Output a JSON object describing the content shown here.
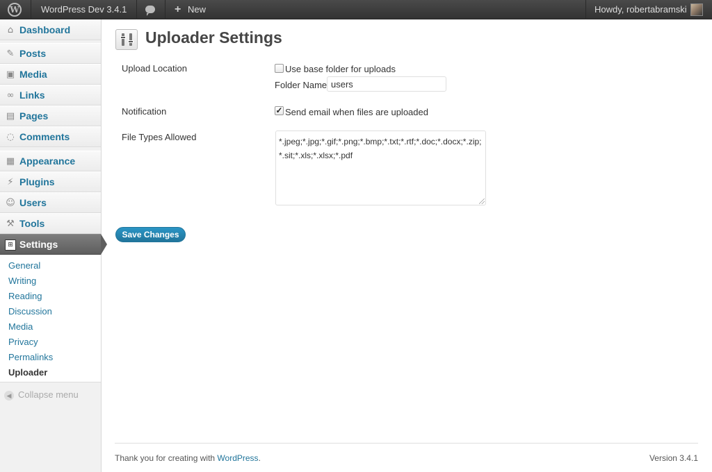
{
  "adminbar": {
    "site_name": "WordPress Dev 3.4.1",
    "new_label": "New",
    "greeting": "Howdy, robertabramski",
    "icons": [
      "wordpress-logo-icon",
      "comment-bubble-icon",
      "plus-icon",
      "avatar-image"
    ]
  },
  "sidebar": {
    "items": [
      {
        "label": "Dashboard",
        "icon": "home-icon"
      },
      {
        "label": "Posts",
        "icon": "pushpin-icon"
      },
      {
        "label": "Media",
        "icon": "media-icon"
      },
      {
        "label": "Links",
        "icon": "link-icon"
      },
      {
        "label": "Pages",
        "icon": "pages-icon"
      },
      {
        "label": "Comments",
        "icon": "comment-icon"
      },
      {
        "label": "Appearance",
        "icon": "appearance-icon"
      },
      {
        "label": "Plugins",
        "icon": "plug-icon"
      },
      {
        "label": "Users",
        "icon": "users-icon"
      },
      {
        "label": "Tools",
        "icon": "tools-icon"
      },
      {
        "label": "Settings",
        "icon": "settings-icon"
      }
    ],
    "submenu": [
      "General",
      "Writing",
      "Reading",
      "Discussion",
      "Media",
      "Privacy",
      "Permalinks",
      "Uploader"
    ],
    "collapse_label": "Collapse menu",
    "accent": "#21759b"
  },
  "main": {
    "title": "Uploader Settings",
    "upload_location_label": "Upload Location",
    "base_folder_label": "Use base folder for uploads",
    "base_folder_checked": false,
    "folder_name_label": "Folder Name",
    "folder_name_value": "users",
    "notification_label": "Notification",
    "send_email_label": "Send email when files are uploaded",
    "send_email_checked": true,
    "file_types_label": "File Types Allowed",
    "file_types_value": "*.jpeg;*.jpg;*.gif;*.png;*.bmp;*.txt;*.rtf;*.doc;*.docx;*.zip;*.sit;*.xls;*.xlsx;*.pdf",
    "save_label": "Save Changes"
  },
  "footer": {
    "thanks_prefix": "Thank you for creating with",
    "thanks_link": "WordPress",
    "thanks_suffix": ".",
    "version": "Version 3.4.1"
  }
}
